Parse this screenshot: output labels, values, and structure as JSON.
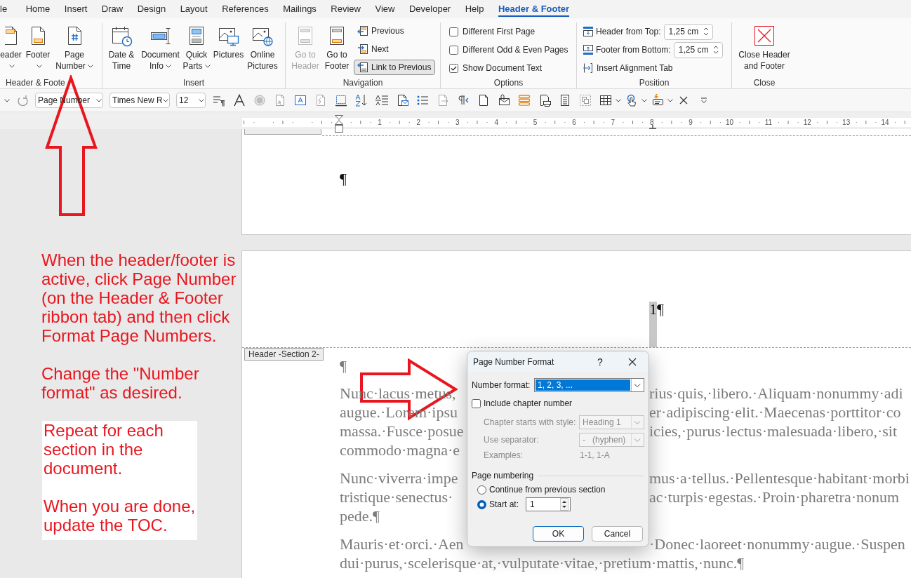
{
  "ribbon_tabs": [
    {
      "label": "le",
      "selected": false
    },
    {
      "label": "Home",
      "selected": false
    },
    {
      "label": "Insert",
      "selected": false
    },
    {
      "label": "Draw",
      "selected": false
    },
    {
      "label": "Design",
      "selected": false
    },
    {
      "label": "Layout",
      "selected": false
    },
    {
      "label": "References",
      "selected": false
    },
    {
      "label": "Mailings",
      "selected": false
    },
    {
      "label": "Review",
      "selected": false
    },
    {
      "label": "View",
      "selected": false
    },
    {
      "label": "Developer",
      "selected": false
    },
    {
      "label": "Help",
      "selected": false
    },
    {
      "label": "Header & Footer",
      "selected": true
    }
  ],
  "ribbon": {
    "header_footer": {
      "label": "Header & Foote",
      "buttons": [
        {
          "label": "eader",
          "dropdown": true
        },
        {
          "label": "Footer",
          "dropdown": true
        },
        {
          "label": "Page\nNumber",
          "dropdown": true
        }
      ]
    },
    "insert": {
      "label": "Insert",
      "buttons": [
        {
          "label": "Date &\nTime",
          "dropdown": false
        },
        {
          "label": "Document\nInfo",
          "dropdown": true
        },
        {
          "label": "Quick\nParts",
          "dropdown": true
        },
        {
          "label": "Pictures",
          "dropdown": false
        },
        {
          "label": "Online\nPictures",
          "dropdown": false
        }
      ]
    },
    "navigation": {
      "label": "Navigation",
      "large": [
        {
          "label": "Go to\nHeader",
          "disabled": true
        },
        {
          "label": "Go to\nFooter",
          "disabled": false
        }
      ],
      "small": [
        {
          "label": "Previous",
          "selected": false
        },
        {
          "label": "Next",
          "selected": false
        },
        {
          "label": "Link to Previous",
          "selected": true
        }
      ]
    },
    "options": {
      "label": "Options",
      "checkboxes": [
        {
          "label": "Different First Page",
          "checked": false
        },
        {
          "label": "Different Odd & Even Pages",
          "checked": false
        },
        {
          "label": "Show Document Text",
          "checked": true
        }
      ]
    },
    "position": {
      "label": "Position",
      "rows": [
        {
          "kind": "spinner",
          "label": "Header from Top:",
          "value": "1,25 cm"
        },
        {
          "kind": "spinner",
          "label": "Footer from Bottom:",
          "value": "1,25 cm"
        },
        {
          "kind": "button",
          "label": "Insert Alignment Tab"
        }
      ]
    },
    "close": {
      "label": "Close",
      "button": "Close Header\nand Footer"
    }
  },
  "quick_access": {
    "style": "Page Number",
    "font": "Times New R",
    "size": "12"
  },
  "ruler": {
    "numbers": [
      "1",
      "2",
      "3",
      "4",
      "5",
      "6",
      "7",
      "8",
      "9",
      "10",
      "11",
      "12",
      "13",
      "14"
    ]
  },
  "document": {
    "footer_mark": "¶",
    "page_number": "1",
    "page_number_mark": "¶",
    "header_tag": "Header -Section 2-",
    "empty_paragraph": "¶",
    "paragraphs": [
      {
        "lines": [
          {
            "left": "Nunc·lacus·metus,",
            "right": "rius·quis,·libero.·Aliquam·nonummy·adi"
          },
          {
            "left": "augue.·Lorem·ipsu",
            "right": "er·adipiscing·elit.·Maecenas·porttitor·co"
          },
          {
            "left": "massa.·Fusce·posue",
            "right": "icies,·purus·lectus·malesuada·libero,·sit"
          },
          {
            "left": "commodo·magna·e"
          }
        ]
      },
      {
        "lines": [
          {
            "left": "Nunc·viverra·impe",
            "right": "mus·a·tellus.·Pellentesque·habitant·morbi"
          },
          {
            "left": "tristique·senectus·",
            "right": "ac·turpis·egestas.·Proin·pharetra·nonum"
          },
          {
            "left": "pede.¶"
          }
        ]
      },
      {
        "lines": [
          {
            "left": "Mauris·et·orci.·Aen",
            "right": "·Donec·laoreet·nonummy·augue.·Suspen"
          },
          {
            "left": "dui·purus,·scelerisque·at,·vulputate·vitae,·pretium·mattis,·nunc.¶"
          }
        ]
      }
    ]
  },
  "annotation": {
    "paragraphs": [
      "When the header/footer is active, click Page Number (on the Header & Footer ribbon tab) and then click Format Page Numbers.",
      "Change the \"Number format\" as desired."
    ],
    "note": [
      "Repeat for each section in the document.",
      "When you are done, update the TOC."
    ]
  },
  "dialog": {
    "title": "Page Number Format",
    "help": "?",
    "number_format": {
      "label": "Number format:",
      "value": "1, 2, 3, ...",
      "focused": true
    },
    "include_chapter": {
      "label": "Include chapter number",
      "checked": false
    },
    "chapter_style": {
      "label": "Chapter starts with style:",
      "value": "Heading 1",
      "disabled": true
    },
    "separator": {
      "label": "Use separator:",
      "value": "-   (hyphen)",
      "disabled": true
    },
    "examples": {
      "label": "Examples:",
      "value": "1-1, 1-A",
      "disabled": true
    },
    "page_numbering": {
      "label": "Page numbering",
      "options": [
        {
          "label": "Continue from previous section",
          "selected": false
        },
        {
          "label": "Start at:",
          "selected": true
        }
      ],
      "start_at": "1"
    },
    "buttons": [
      "OK",
      "Cancel"
    ]
  }
}
